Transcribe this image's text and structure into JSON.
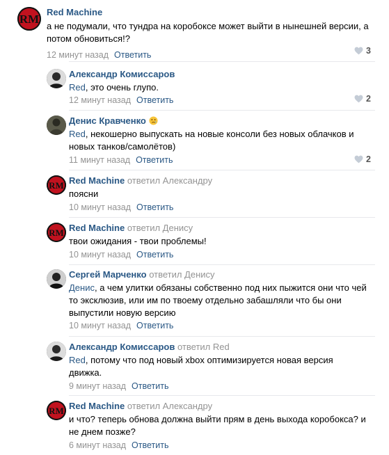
{
  "comments": [
    {
      "author": "Red Machine",
      "reply_to": "",
      "text_mention": "",
      "text": "а не подумали, что тундра на коробоксе может выйти в нынешней версии, а потом обновиться!?",
      "time": "12 минут назад",
      "reply_label": "Ответить",
      "likes": "3",
      "avatar": "red-machine"
    },
    {
      "author": "Александр Комиссаров",
      "reply_to": "",
      "text_mention": "Red",
      "text": ", это очень глупо.",
      "time": "12 минут назад",
      "reply_label": "Ответить",
      "likes": "2",
      "avatar": "alexander"
    },
    {
      "author": "Денис Кравченко",
      "reply_to": "",
      "text_mention": "Red",
      "text": ", некошерно выпускать на новые консоли без новых облачков и новых танков/самолётов)",
      "time": "11 минут назад",
      "reply_label": "Ответить",
      "likes": "2",
      "avatar": "denis"
    },
    {
      "author": "Red Machine",
      "reply_to": "ответил Александру",
      "text_mention": "",
      "text": "поясни",
      "time": "10 минут назад",
      "reply_label": "Ответить",
      "likes": "",
      "avatar": "red-machine"
    },
    {
      "author": "Red Machine",
      "reply_to": "ответил Денису",
      "text_mention": "",
      "text": "твои ожидания - твои проблемы!",
      "time": "10 минут назад",
      "reply_label": "Ответить",
      "likes": "",
      "avatar": "red-machine"
    },
    {
      "author": "Сергей Марченко",
      "reply_to": "ответил Денису",
      "text_mention": "Денис",
      "text": ", а чем улитки обязаны собственно под них пыжится они что чей то эксклюзив, или им по твоему отдельно забашляли что бы они выпустили новую версию",
      "time": "10 минут назад",
      "reply_label": "Ответить",
      "likes": "",
      "avatar": "sergey"
    },
    {
      "author": "Александр Комиссаров",
      "reply_to": "ответил Red",
      "text_mention": "Red",
      "text": ", потому что под новый xbox оптимизируется новая версия движка.",
      "time": "9 минут назад",
      "reply_label": "Ответить",
      "likes": "",
      "avatar": "alexander"
    },
    {
      "author": "Red Machine",
      "reply_to": "ответил Александру",
      "text_mention": "",
      "text": "и что? теперь обнова должна выйти прям в день выхода коробокса? и не днем позже?",
      "time": "6 минут назад",
      "reply_label": "Ответить",
      "likes": "",
      "avatar": "red-machine"
    }
  ]
}
